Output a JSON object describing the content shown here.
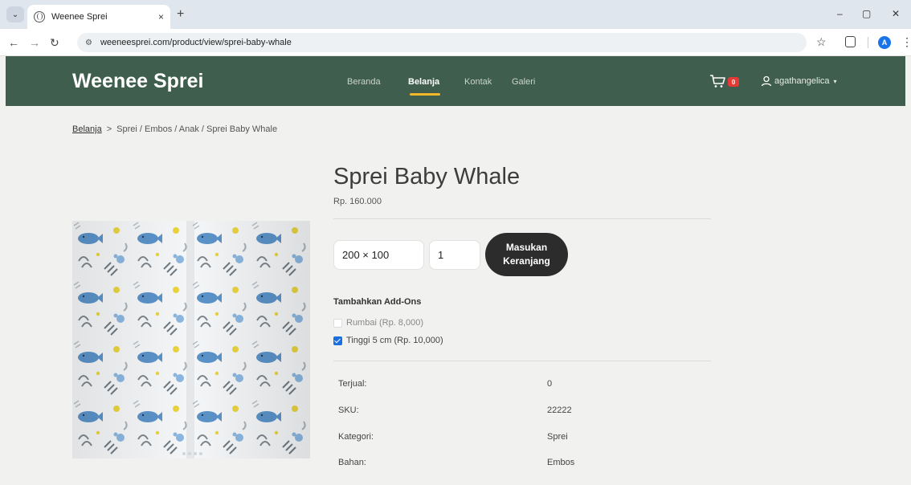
{
  "browser": {
    "tab_title": "Weenee Sprei",
    "tab_close": "×",
    "new_tab": "+",
    "url": "weeneesprei.com/product/view/sprei-baby-whale",
    "profile_initial": "A",
    "window_minimize": "–",
    "window_restore": "▢",
    "window_close": "✕"
  },
  "site": {
    "brand": "Weenee Sprei",
    "menu": [
      "Beranda",
      "Belanja",
      "Kontak",
      "Galeri"
    ],
    "active_menu": "Belanja",
    "cart_count": "0",
    "username": "agathangelica",
    "user_caret": "▾"
  },
  "breadcrumb": {
    "link": "Belanja",
    "separator": ">",
    "rest": "Sprei / Embos / Anak / Sprei Baby Whale"
  },
  "product": {
    "title": "Sprei Baby Whale",
    "price": "Rp. 160.000",
    "size_value": "200 × 100",
    "quantity": "1",
    "add_to_cart": "Masukan Keranjang",
    "addons_heading": "Tambahkan Add-Ons",
    "addons": [
      {
        "label": "Rumbai (Rp. 8,000)",
        "checked": false
      },
      {
        "label": "Tinggi 5 cm (Rp. 10,000)",
        "checked": true
      }
    ],
    "info": [
      {
        "label": "Terjual:",
        "value": "0"
      },
      {
        "label": "SKU:",
        "value": "22222"
      },
      {
        "label": "Kategori:",
        "value": "Sprei"
      },
      {
        "label": "Bahan:",
        "value": "Embos"
      }
    ]
  },
  "colors": {
    "nav_bg": "#3f5e4d",
    "accent": "#f3b72a",
    "button": "#2c2c2c",
    "badge": "#e53935"
  }
}
